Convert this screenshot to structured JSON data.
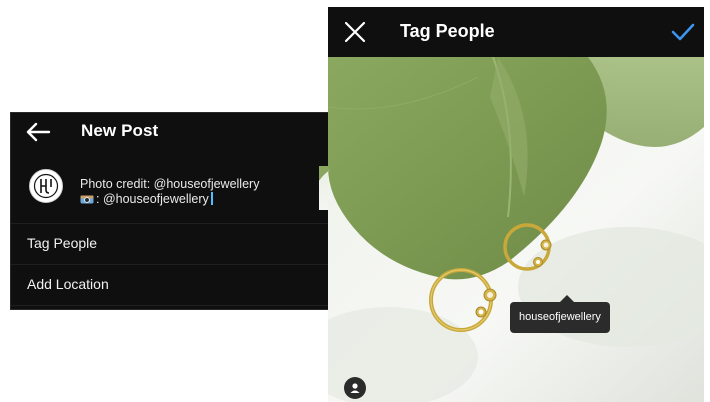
{
  "new_post": {
    "title": "New Post",
    "back_icon": "back-arrow-icon",
    "confirm_icon": "checkmark-icon",
    "caption_line1": "Photo credit: @houseofjewellery",
    "caption_line2": ": @houseofjewellery",
    "caption_icon": "camera-icon",
    "avatar_text": "JH",
    "rows": [
      {
        "label": "Tag People"
      },
      {
        "label": "Add Location"
      }
    ]
  },
  "tag_people": {
    "title": "Tag People",
    "close_icon": "close-icon",
    "confirm_icon": "checkmark-icon",
    "tag_label": "houseofjewellery",
    "user_button_icon": "user-icon"
  },
  "colors": {
    "panel_bg": "#0f0f10",
    "accent_blue": "#3d95ef",
    "tag_bg": "#2b2b2b",
    "leaf_green": "#7f9b57",
    "gold": "#c9a83a"
  }
}
